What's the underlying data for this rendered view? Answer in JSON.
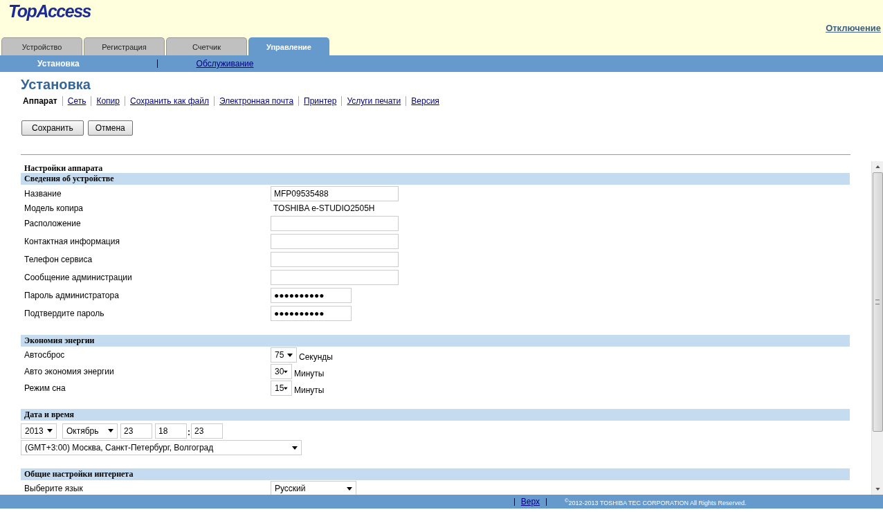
{
  "logo": "TopAccess",
  "logout": "Отключение",
  "tabs": [
    {
      "label": "Устройство",
      "selected": false
    },
    {
      "label": "Регистрация",
      "selected": false
    },
    {
      "label": "Счетчик",
      "selected": false
    },
    {
      "label": "Управление",
      "selected": true
    }
  ],
  "subnav": [
    {
      "label": "Установка",
      "selected": true
    },
    {
      "label": "Обслуживание",
      "selected": false
    }
  ],
  "page_title": "Установка",
  "page_links": [
    {
      "label": "Аппарат",
      "selected": true
    },
    {
      "label": "Сеть",
      "selected": false
    },
    {
      "label": "Копир",
      "selected": false
    },
    {
      "label": "Сохранить как файл",
      "selected": false
    },
    {
      "label": "Электронная почта",
      "selected": false
    },
    {
      "label": "Принтер",
      "selected": false
    },
    {
      "label": "Услуги печати",
      "selected": false
    },
    {
      "label": "Версия",
      "selected": false
    }
  ],
  "buttons": [
    "Сохранить",
    "Отмена"
  ],
  "panel_title": "Настройки аппарата",
  "sections": [
    {
      "title": "Сведения об устройстве",
      "rows": [
        {
          "kind": "input",
          "label": "Название",
          "value": "MFP09535488"
        },
        {
          "kind": "text",
          "label": "Модель копира",
          "value": "TOSHIBA e-STUDIO2505H"
        },
        {
          "kind": "input",
          "label": "Расположение"
        },
        {
          "kind": "input",
          "label": "Контактная информация"
        },
        {
          "kind": "input",
          "label": "Телефон сервиса"
        },
        {
          "kind": "input",
          "label": "Сообщение администрации"
        },
        {
          "kind": "password",
          "label": "Пароль администратора",
          "value": "●●●●●●●●●●"
        },
        {
          "kind": "password",
          "label": "Подтвердите пароль",
          "value": "●●●●●●●●●●"
        }
      ]
    },
    {
      "title": "Экономия энергии",
      "rows": [
        {
          "kind": "select",
          "label": "Автосброс",
          "value": "75",
          "unit": "Секунды"
        },
        {
          "kind": "select",
          "label": "Авто экономия энергии",
          "value": "30",
          "unit": "Минуты"
        },
        {
          "kind": "select",
          "label": "Режим сна",
          "value": "15",
          "unit": "Минуты"
        }
      ]
    },
    {
      "title": "Дата и время",
      "rows": [
        {
          "kind": "datetime",
          "year": "2013",
          "month": "Октябрь",
          "day": "23",
          "hour": "18",
          "separator": ":",
          "minute": "23"
        },
        {
          "kind": "timezone",
          "value": "(GMT+3:00) Москва, Санкт-Петербург, Волгоград"
        }
      ]
    },
    {
      "title": "Общие настройки интернета",
      "rows": [
        {
          "kind": "select",
          "label": "Выберите язык",
          "value": "Русский"
        }
      ]
    }
  ],
  "footer": {
    "link": "Верх",
    "copyright": "$^{©}$2012-2013 TOSHIBA TEC CORPORATION All Rights Reserved."
  }
}
